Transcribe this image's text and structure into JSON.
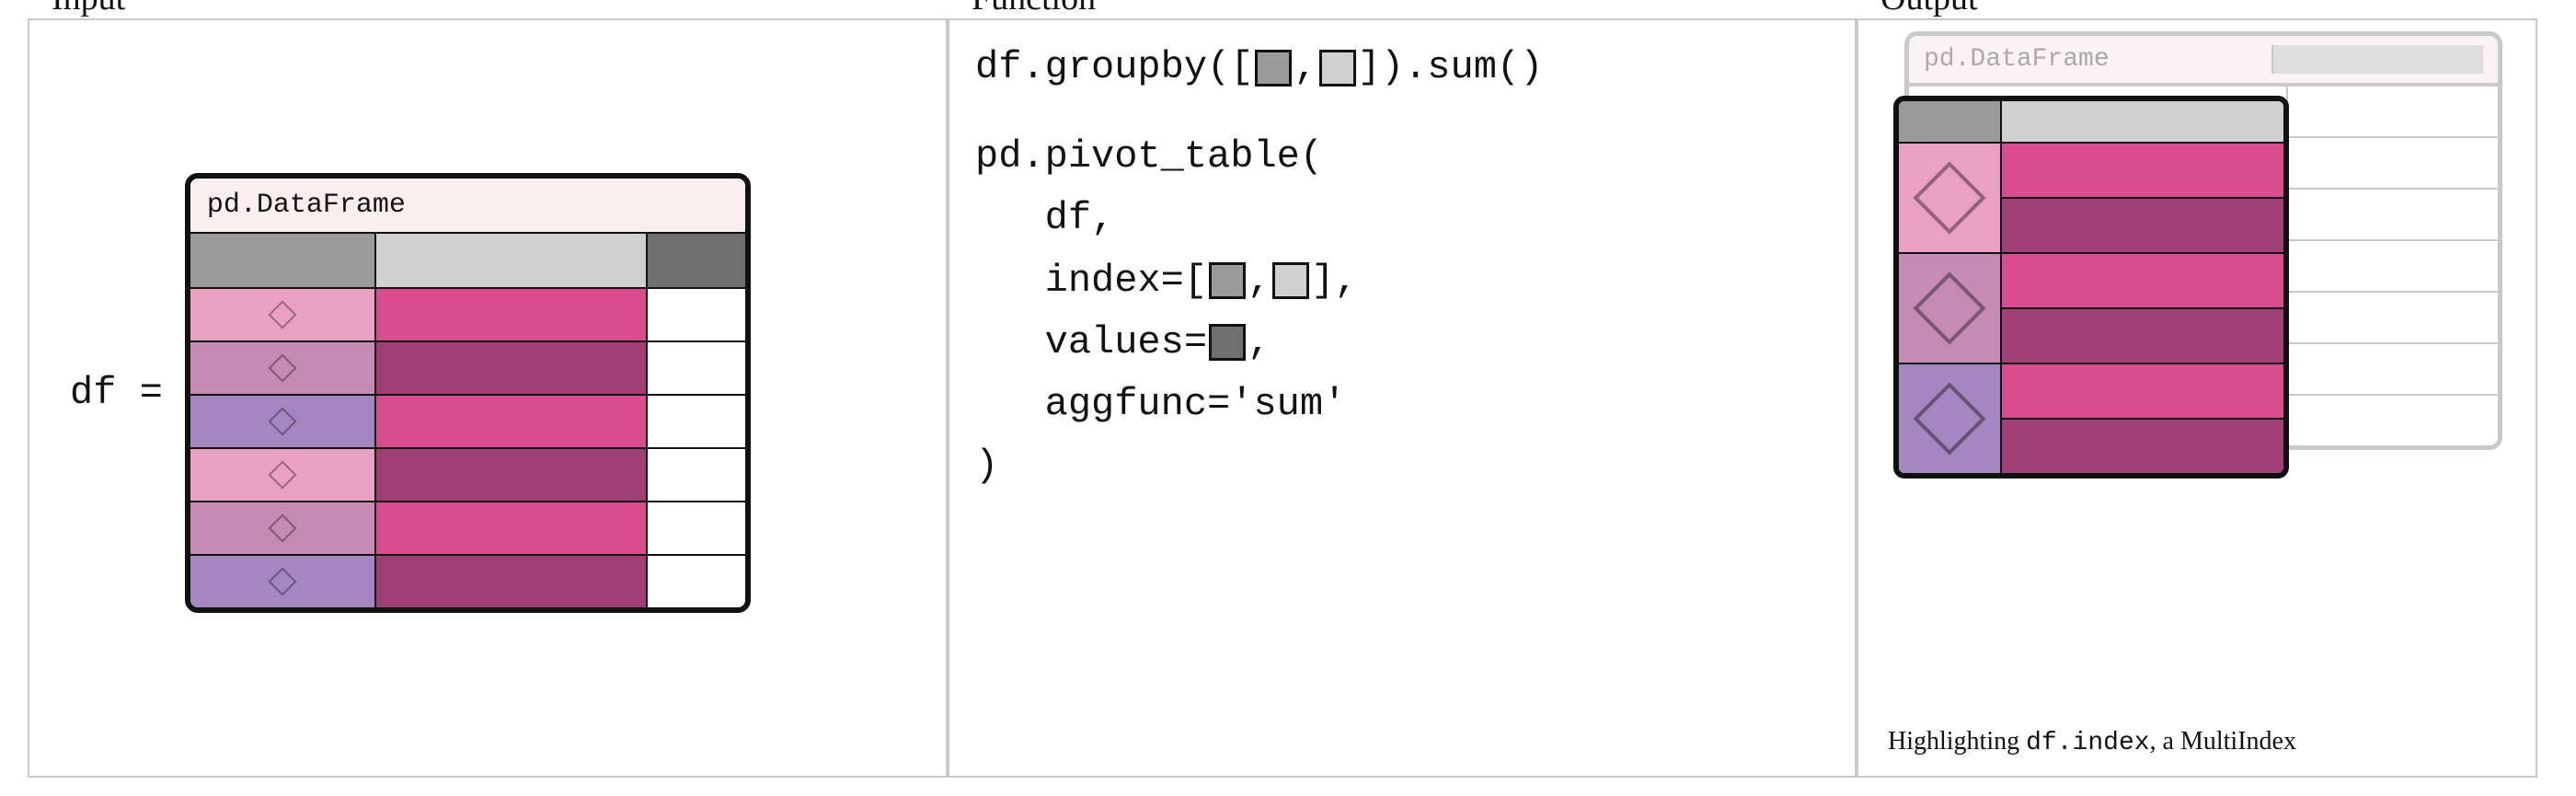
{
  "labels": {
    "input": "Input",
    "function": "Function",
    "output": "Output"
  },
  "input": {
    "assign": "df = ",
    "frame_label": "pd.DataFrame",
    "header_colors": [
      "mid",
      "lt",
      "dk"
    ],
    "rows": [
      {
        "index_color": "pink1",
        "value_color": "hot1"
      },
      {
        "index_color": "pink2",
        "value_color": "hot2"
      },
      {
        "index_color": "purp",
        "value_color": "hot1"
      },
      {
        "index_color": "pink1",
        "value_color": "hot2"
      },
      {
        "index_color": "pink2",
        "value_color": "hot1"
      },
      {
        "index_color": "purp",
        "value_color": "hot2"
      }
    ]
  },
  "function": {
    "line1_a": "df.groupby([",
    "line1_b": ",",
    "line1_c": "]).sum()",
    "pivot_open": "pd.pivot_table(",
    "pivot_df": "   df,",
    "pivot_index_a": "   index=[",
    "pivot_index_b": ",",
    "pivot_index_c": "],",
    "pivot_values_a": "   values=",
    "pivot_values_b": ",",
    "pivot_agg": "   aggfunc='sum'",
    "pivot_close": ")"
  },
  "output": {
    "frame_label": "pd.DataFrame",
    "groups": [
      {
        "index_color": "pink1"
      },
      {
        "index_color": "pink2"
      },
      {
        "index_color": "purp"
      }
    ],
    "caption_a": "Highlighting ",
    "caption_code": "df.index",
    "caption_b": ", a MultiIndex"
  }
}
